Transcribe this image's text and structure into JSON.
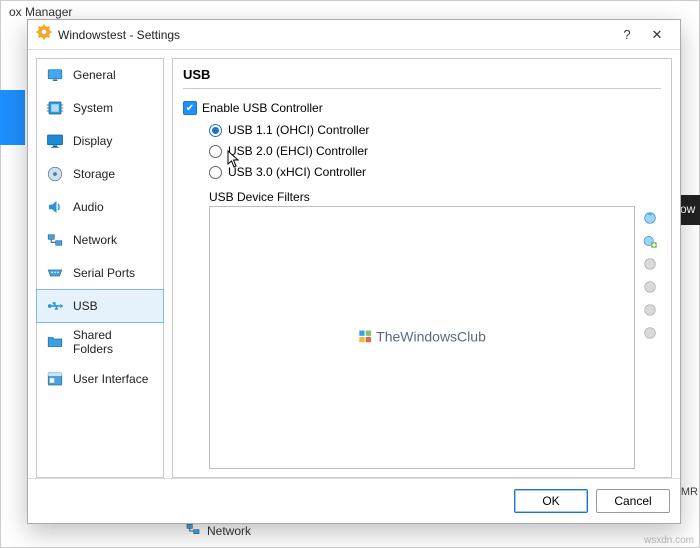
{
  "background": {
    "title": "ox Manager",
    "right_fragment": "ow",
    "oem_fragment": "_OEMR",
    "network_label": "Network",
    "site_watermark": "wsxdn.com"
  },
  "dialog": {
    "title": "Windowstest - Settings",
    "help": "?",
    "close": "✕"
  },
  "sidebar": {
    "items": [
      {
        "label": "General"
      },
      {
        "label": "System"
      },
      {
        "label": "Display"
      },
      {
        "label": "Storage"
      },
      {
        "label": "Audio"
      },
      {
        "label": "Network"
      },
      {
        "label": "Serial Ports"
      },
      {
        "label": "USB"
      },
      {
        "label": "Shared Folders"
      },
      {
        "label": "User Interface"
      }
    ]
  },
  "content": {
    "heading": "USB",
    "enable_label": "Enable USB Controller",
    "radios": {
      "r1": "USB 1.1 (OHCI) Controller",
      "r2": "USB 2.0 (EHCI) Controller",
      "r3": "USB 3.0 (xHCI) Controller"
    },
    "filters_label": "USB Device Filters",
    "watermark": "TheWindowsClub"
  },
  "footer": {
    "ok": "OK",
    "cancel": "Cancel"
  }
}
